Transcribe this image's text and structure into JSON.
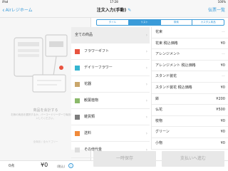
{
  "statusbar": {
    "carrier": "iPad",
    "time": "17:28",
    "battery": "100%"
  },
  "nav": {
    "back_label": "Airレジホーム",
    "title": "注文入力(手動)",
    "right_label": "伝票一覧"
  },
  "left_panel": {
    "hint_title": "商品を会計する",
    "hint_body": "右側の商品を選択するか、バーコードリーダーで商品をスキャンしてください。",
    "hint_sub": "全商品 / 全カテゴリー"
  },
  "segments": [
    {
      "label": "タイル",
      "active": false
    },
    {
      "label": "リスト",
      "active": true
    },
    {
      "label": "検索",
      "active": false
    },
    {
      "label": "カスタム商品",
      "active": false
    }
  ],
  "categories": [
    {
      "label": "全ての商品",
      "color": "",
      "selected": true
    },
    {
      "label": "フラワーギフト",
      "color": "#e8533f",
      "selected": false
    },
    {
      "label": "デイリーフラワー",
      "color": "#35b5d0",
      "selected": false
    },
    {
      "label": "花器",
      "color": "#c9a66b",
      "selected": false
    },
    {
      "label": "観葉植物",
      "color": "#8bb96a",
      "selected": false
    },
    {
      "label": "雑貨類",
      "color": "#7d7d7d",
      "selected": false
    },
    {
      "label": "送料",
      "color": "#f08a3a",
      "selected": false
    },
    {
      "label": "その他代金",
      "color": "#dddddd",
      "selected": false
    }
  ],
  "products": [
    {
      "name": "花束",
      "price": "—",
      "dim": true
    },
    {
      "name": "花束 税込価格",
      "price": "¥0",
      "dim": false
    },
    {
      "name": "アレンジメント",
      "price": "—",
      "dim": true
    },
    {
      "name": "アレンジメント 税込価格",
      "price": "¥0",
      "dim": false
    },
    {
      "name": "スタンド装花",
      "price": "—",
      "dim": true
    },
    {
      "name": "スタンド装花 税込価格",
      "price": "¥0",
      "dim": false
    },
    {
      "name": "鉢",
      "price": "¥200",
      "dim": false
    },
    {
      "name": "仏花",
      "price": "¥500",
      "dim": false
    },
    {
      "name": "枝物",
      "price": "¥0",
      "dim": false
    },
    {
      "name": "グリーン",
      "price": "¥0",
      "dim": false
    },
    {
      "name": "小物",
      "price": "¥0",
      "dim": false
    }
  ],
  "footer": {
    "count": "0点",
    "total": "¥0",
    "tax_note": "(税込)",
    "info_icon": "i",
    "hold_button": "一時保存",
    "pay_button": "支払いへ進む"
  },
  "colors": {
    "accent": "#3a9bd9"
  }
}
